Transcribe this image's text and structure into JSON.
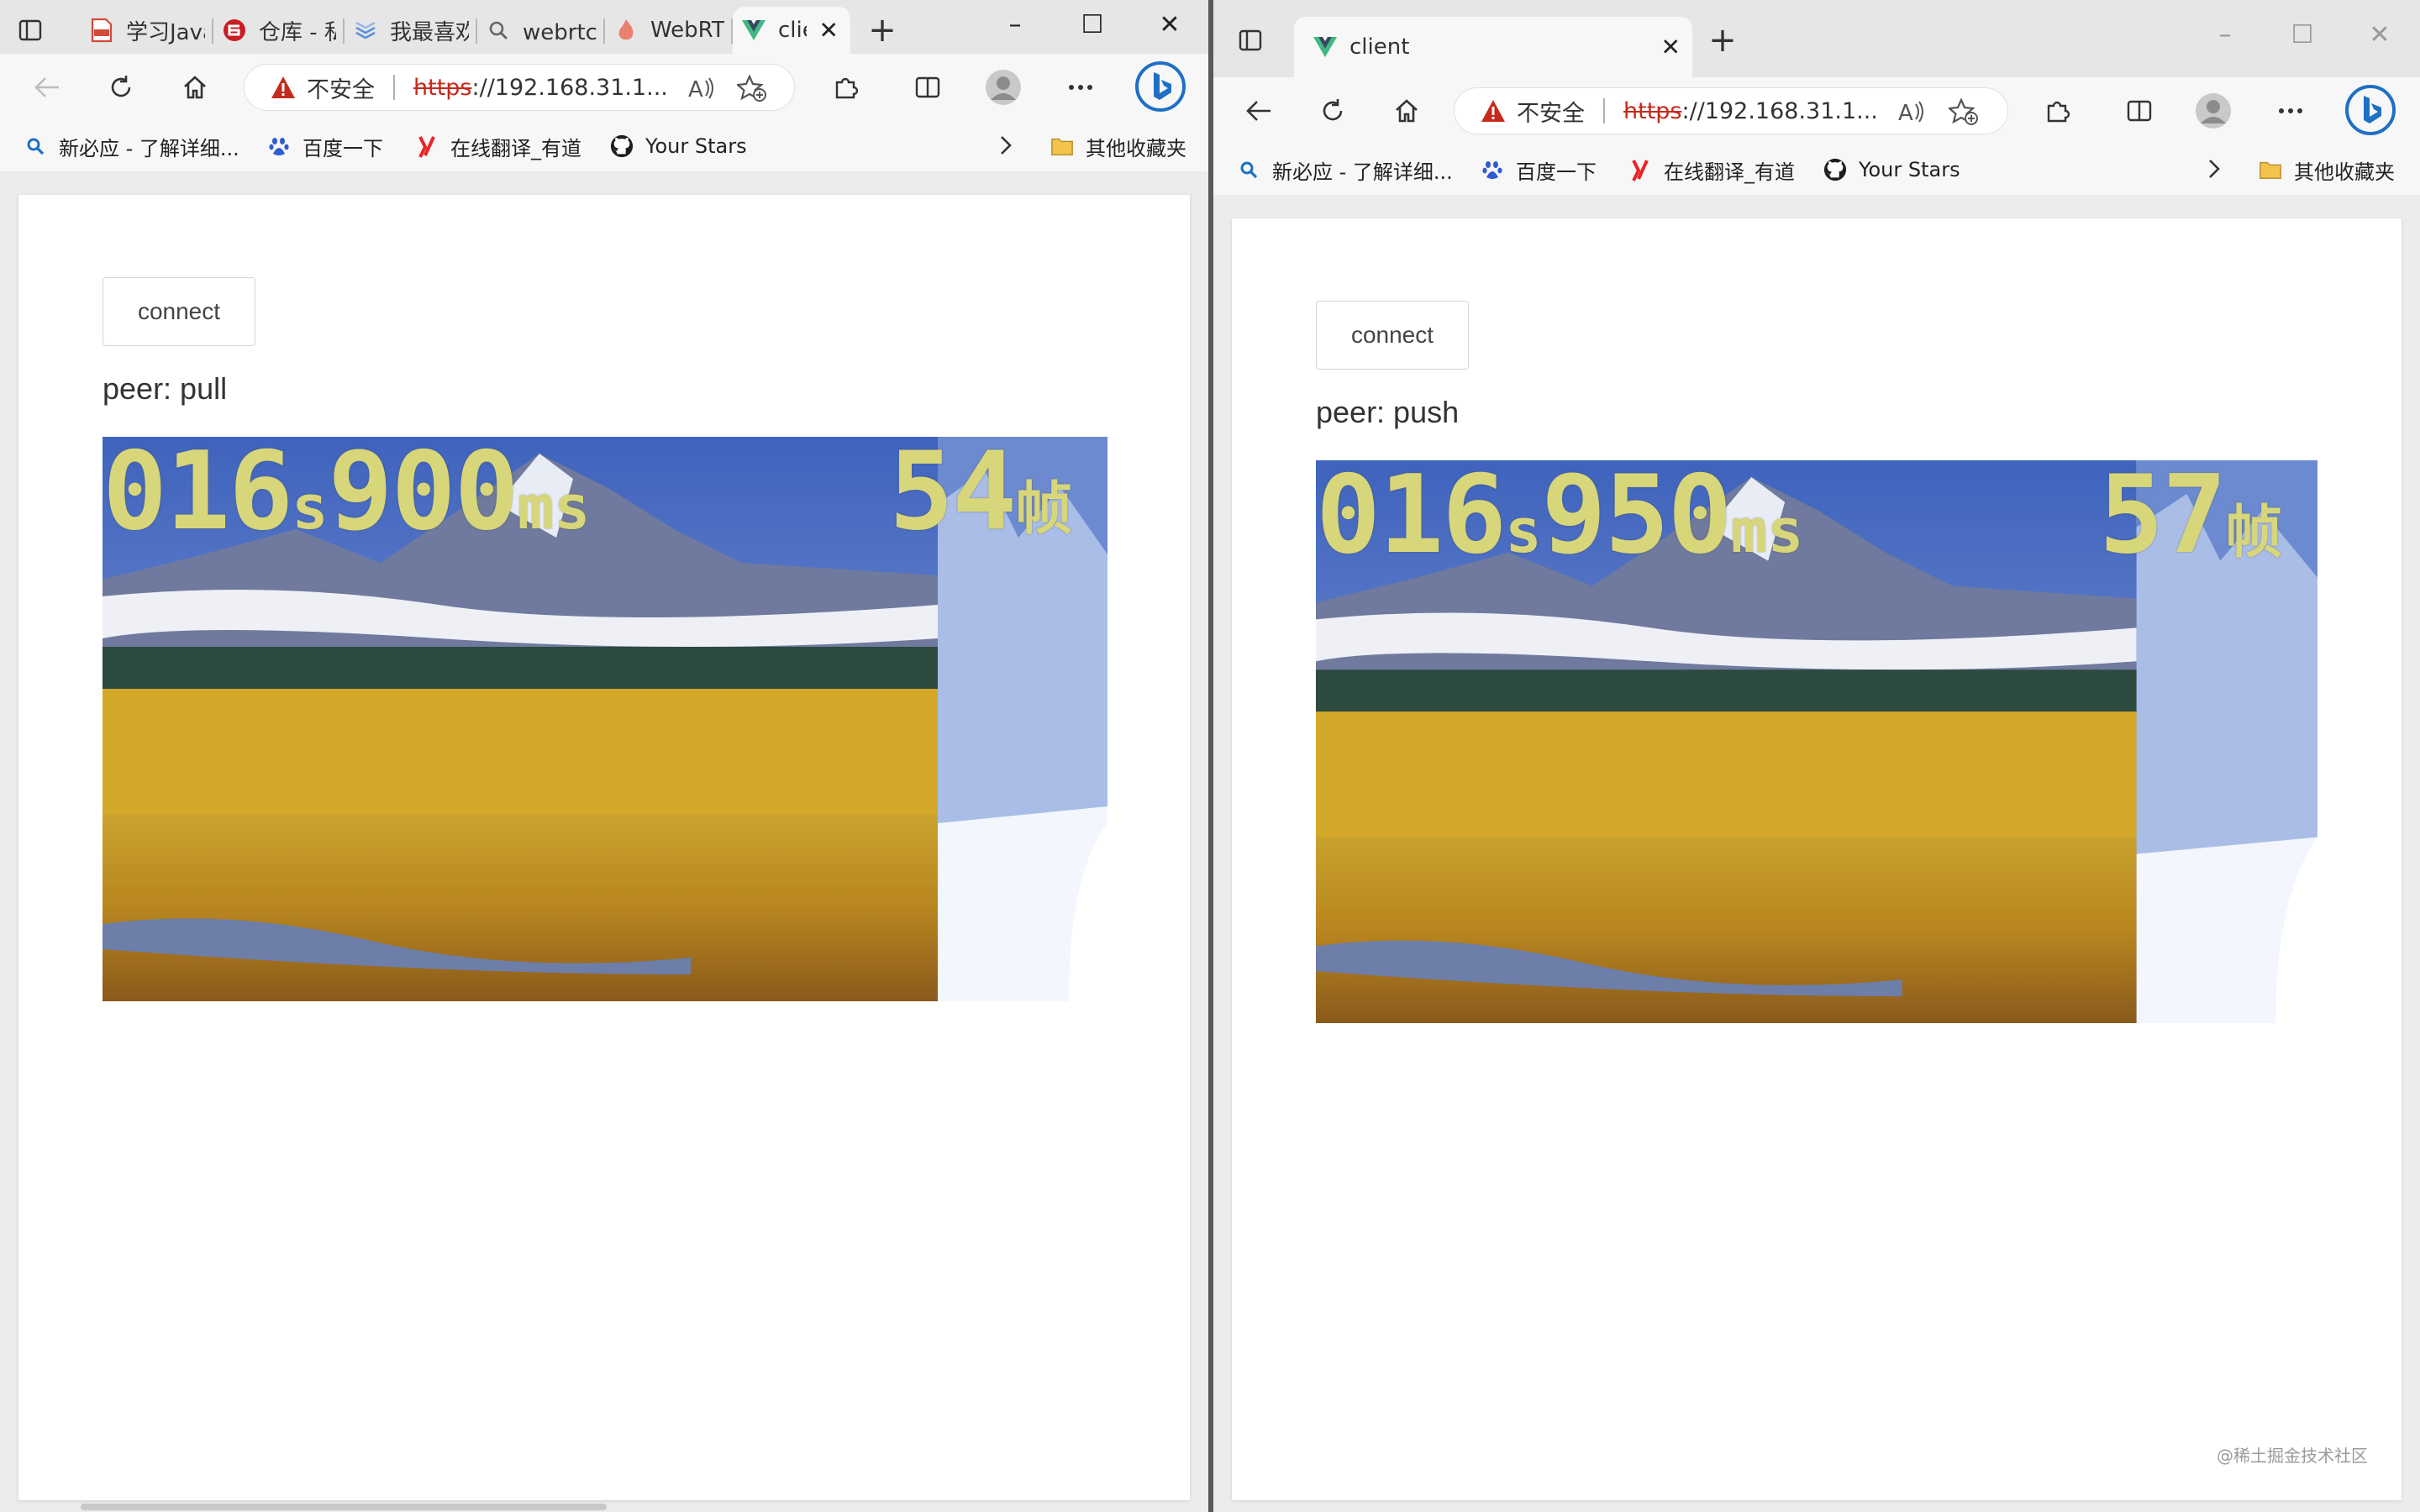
{
  "left_window": {
    "tabs": [
      {
        "label": "学习Java",
        "icon": "pdf-icon"
      },
      {
        "label": "仓库 - 私",
        "icon": "gitee-icon"
      },
      {
        "label": "我最喜欢",
        "icon": "stack-icon"
      },
      {
        "label": "webrtc的",
        "icon": "search-icon"
      },
      {
        "label": "WebRTC",
        "icon": "flame-icon"
      },
      {
        "label": "client",
        "icon": "vue-icon",
        "active": true
      }
    ],
    "address": {
      "insecure_label": "不安全",
      "url_scheme": "https",
      "url_rest": "://192.168.31.1..."
    },
    "page": {
      "button_label": "connect",
      "peer_label": "peer: pull",
      "overlay_time": "016",
      "overlay_s": "s",
      "overlay_ms_value": "900",
      "overlay_ms": "ms",
      "overlay_fps": "54",
      "overlay_fps_unit": "帧"
    }
  },
  "right_window": {
    "tabs": [
      {
        "label": "client",
        "icon": "vue-icon",
        "active": true
      }
    ],
    "address": {
      "insecure_label": "不安全",
      "url_scheme": "https",
      "url_rest": "://192.168.31.1..."
    },
    "page": {
      "button_label": "connect",
      "peer_label": "peer: push",
      "overlay_time": "016",
      "overlay_s": "s",
      "overlay_ms_value": "950",
      "overlay_ms": "ms",
      "overlay_fps": "57",
      "overlay_fps_unit": "帧"
    },
    "watermark": "@稀土掘金技术社区"
  },
  "bookmarks": [
    {
      "label": "新必应 - 了解详细...",
      "icon": "bing-search-icon"
    },
    {
      "label": "百度一下",
      "icon": "baidu-paw-icon"
    },
    {
      "label": "在线翻译_有道",
      "icon": "youdao-icon"
    },
    {
      "label": "Your Stars",
      "icon": "github-icon"
    }
  ],
  "other_favorites": "其他收藏夹",
  "colors": {
    "overlay_text": "#d8d67a",
    "warning_red": "#c42b1c",
    "vue_green": "#41b883",
    "bing_blue": "#1f6fc5"
  }
}
